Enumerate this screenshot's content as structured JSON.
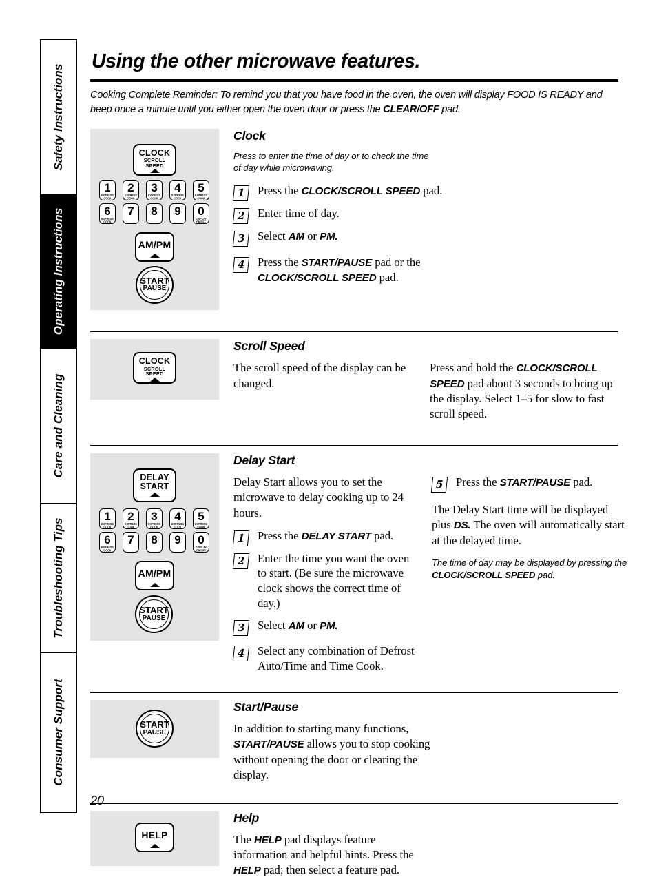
{
  "sidebar": {
    "tabs": [
      {
        "label": "Safety Instructions",
        "active": false
      },
      {
        "label": "Operating Instructions",
        "active": true
      },
      {
        "label": "Care and Cleaning",
        "active": false
      },
      {
        "label": "Troubleshooting Tips",
        "active": false
      },
      {
        "label": "Consumer Support",
        "active": false
      }
    ]
  },
  "header": {
    "title": "Using the other microwave features.",
    "intro_line1": "Cooking Complete Reminder: To remind you that you have food in the oven, the oven will display FOOD IS READY and",
    "intro_line2_a": "beep once a minute until you either open the oven door or press the ",
    "intro_bold": "CLEAR/OFF",
    "intro_line2_b": " pad."
  },
  "pads": {
    "clock": {
      "line1": "CLOCK",
      "line2": "SCROLL SPEED"
    },
    "delay_start": {
      "line1": "DELAY",
      "line2": "START"
    },
    "am_pm": {
      "line1": "AM/PM"
    },
    "start_pause": {
      "line1": "START",
      "line2": "PAUSE"
    },
    "help": {
      "line1": "HELP"
    },
    "keypad": [
      {
        "digit": "1",
        "sub": "EXPRESS COOK"
      },
      {
        "digit": "2",
        "sub": "EXPRESS COOK"
      },
      {
        "digit": "3",
        "sub": "EXPRESS COOK"
      },
      {
        "digit": "4",
        "sub": "EXPRESS COOK"
      },
      {
        "digit": "5",
        "sub": "EXPRESS COOK"
      },
      {
        "digit": "6",
        "sub": "EXPRESS COOK"
      },
      {
        "digit": "7",
        "sub": ""
      },
      {
        "digit": "8",
        "sub": ""
      },
      {
        "digit": "9",
        "sub": ""
      },
      {
        "digit": "0",
        "sub": "DISPLAY ON/OFF"
      }
    ]
  },
  "sections": {
    "clock": {
      "heading": "Clock",
      "caption_l1": "Press to enter the time of day or to check the time",
      "caption_l2": "of day while microwaving.",
      "steps": [
        {
          "num": "1",
          "pre": "Press the ",
          "bold": "CLOCK/SCROLL SPEED",
          "post": " pad."
        },
        {
          "num": "2",
          "pre": "Enter time of day.",
          "bold": "",
          "post": ""
        },
        {
          "num": "3",
          "pre": "Select ",
          "bold": "AM",
          "mid": " or ",
          "bold2": "PM.",
          "post": ""
        },
        {
          "num": "4",
          "pre": "Press the ",
          "bold": "START/PAUSE",
          "post": " pad or the ",
          "bold2": "CLOCK/SCROLL SPEED",
          "post2": " pad."
        }
      ]
    },
    "scroll_speed": {
      "heading": "Scroll Speed",
      "left_text": "The scroll speed of the display can be changed.",
      "right_pre": "Press and hold the ",
      "right_bold": "CLOCK/SCROLL SPEED",
      "right_post": " pad about 3 seconds to bring up the display. Select 1–5 for slow to fast scroll speed."
    },
    "delay_start": {
      "heading": "Delay Start",
      "intro": "Delay Start allows you to set the microwave to delay cooking up to 24 hours.",
      "steps": [
        {
          "num": "1",
          "pre": "Press the ",
          "bold": "DELAY START",
          "post": " pad."
        },
        {
          "num": "2",
          "pre": "Enter the time you want the oven to start. (Be sure the microwave clock shows the correct time of day.)",
          "bold": "",
          "post": ""
        },
        {
          "num": "3",
          "pre": "Select ",
          "bold": "AM",
          "mid": "  or ",
          "bold2": "PM.",
          "post": ""
        },
        {
          "num": "4",
          "pre": "Select any combination of Defrost Auto/Time and Time Cook.",
          "bold": "",
          "post": ""
        }
      ],
      "step5": {
        "num": "5",
        "pre": "Press the ",
        "bold": "START/PAUSE",
        "post": " pad."
      },
      "note_pre": "The Delay Start time will be displayed plus ",
      "note_bold": "DS.",
      "note_post": "  The oven will automatically start at the delayed time.",
      "italic_pre": "The time of day may be displayed by pressing the ",
      "italic_bold": "CLOCK/SCROLL SPEED",
      "italic_post": " pad."
    },
    "start_pause": {
      "heading": "Start/Pause",
      "text_pre": "In addition to starting many functions, ",
      "text_bold": "START/PAUSE",
      "text_post": " allows you to stop cooking without opening the door or clearing the display."
    },
    "help": {
      "heading": "Help",
      "text_pre": "The ",
      "text_bold": "HELP",
      "text_mid": " pad displays feature information and helpful hints. Press the ",
      "text_bold2": "HELP",
      "text_post": " pad; then select a feature pad."
    }
  },
  "footer": {
    "page_number": "20"
  },
  "colors": {
    "panel_gray": "#e4e4e4",
    "ink": "#000000",
    "paper": "#ffffff"
  }
}
